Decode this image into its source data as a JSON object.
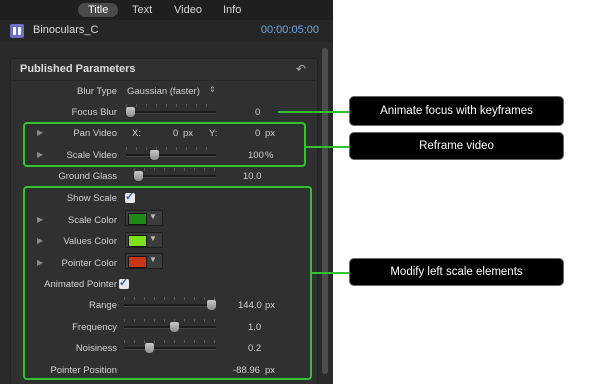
{
  "tabs": [
    "Title",
    "Text",
    "Video",
    "Info"
  ],
  "active_tab": "Title",
  "clip": {
    "name": "Binoculars_C",
    "timecode": "00:00:05:00"
  },
  "section_title": "Published Parameters",
  "blur_type": {
    "label": "Blur Type",
    "value": "Gaussian (faster)"
  },
  "focus_blur": {
    "label": "Focus Blur",
    "value": "0",
    "level": 0.0
  },
  "pan_video": {
    "label": "Pan Video",
    "x_label": "X:",
    "x_value": "0",
    "x_unit": "px",
    "y_label": "Y:",
    "y_value": "0",
    "y_unit": "px"
  },
  "scale_video": {
    "label": "Scale Video",
    "value": "100",
    "unit": "%",
    "level": 0.3
  },
  "ground_glass": {
    "label": "Ground Glass",
    "value": "10.0",
    "level": 0.0
  },
  "show_scale": {
    "label": "Show Scale",
    "checked": true
  },
  "scale_color": {
    "label": "Scale Color",
    "color": "#1f8a1a"
  },
  "values_color": {
    "label": "Values Color",
    "color": "#7ee21a"
  },
  "pointer_color": {
    "label": "Pointer Color",
    "color": "#c8361a"
  },
  "animated_pointer": {
    "label": "Animated Pointer",
    "checked": true
  },
  "range": {
    "label": "Range",
    "value": "144.0",
    "unit": "px",
    "level": 1.0
  },
  "frequency": {
    "label": "Frequency",
    "value": "1.0",
    "level": 0.55
  },
  "noisiness": {
    "label": "Noisiness",
    "value": "0.2",
    "level": 0.25
  },
  "pointer_position": {
    "label": "Pointer Position",
    "value": "-88.96",
    "unit": "px"
  },
  "callouts": {
    "focus": "Animate focus with keyframes",
    "reframe": "Reframe video",
    "scale": "Modify left scale elements"
  },
  "accent_green": "#2fc42f",
  "timecode_color": "#6aa6e0"
}
